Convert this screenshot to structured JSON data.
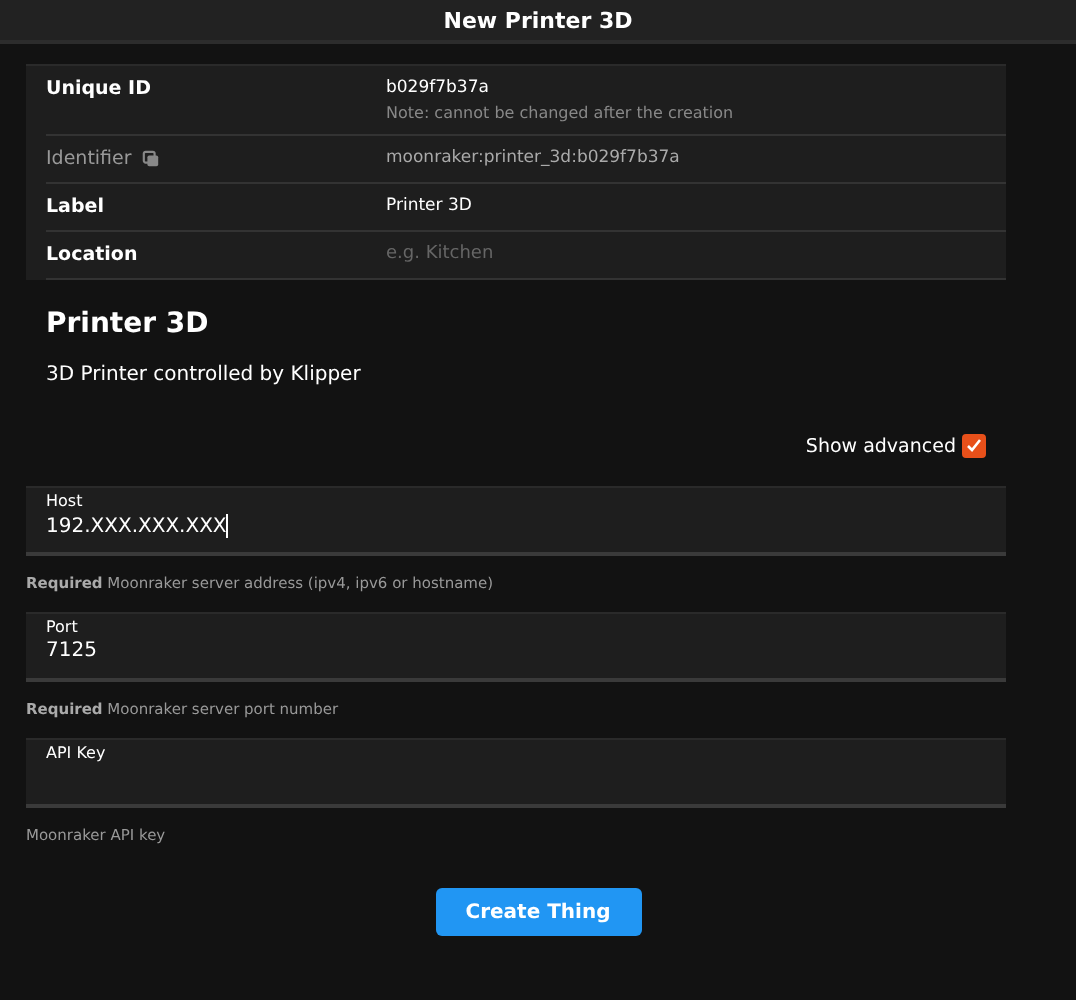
{
  "window": {
    "title": "New Printer 3D"
  },
  "properties": [
    {
      "kind": "value",
      "label": "Unique ID",
      "value": "b029f7b37a",
      "note": "Note: cannot be changed after the creation"
    },
    {
      "kind": "copy",
      "label": "Identifier",
      "value": "moonraker:printer_3d:b029f7b37a"
    },
    {
      "kind": "value",
      "label": "Label",
      "value": "Printer 3D"
    },
    {
      "kind": "input",
      "label": "Location",
      "placeholder": "e.g. Kitchen"
    }
  ],
  "binding": {
    "title": "Printer 3D",
    "description": "3D Printer controlled by Klipper"
  },
  "show_advanced": {
    "label": "Show advanced",
    "checked": true
  },
  "fields": [
    {
      "label": "Host",
      "value": "192.XXX.XXX.XXX",
      "focused": true,
      "help": "**Required** Moonraker server address (ipv4, ipv6 or hostname)"
    },
    {
      "label": "Port",
      "value": "7125",
      "focused": false,
      "help": "**Required** Moonraker server port number"
    },
    {
      "label": "API Key",
      "focused": false,
      "help": "Moonraker API key"
    }
  ],
  "buttons": [
    {
      "label": "Create Thing"
    }
  ]
}
